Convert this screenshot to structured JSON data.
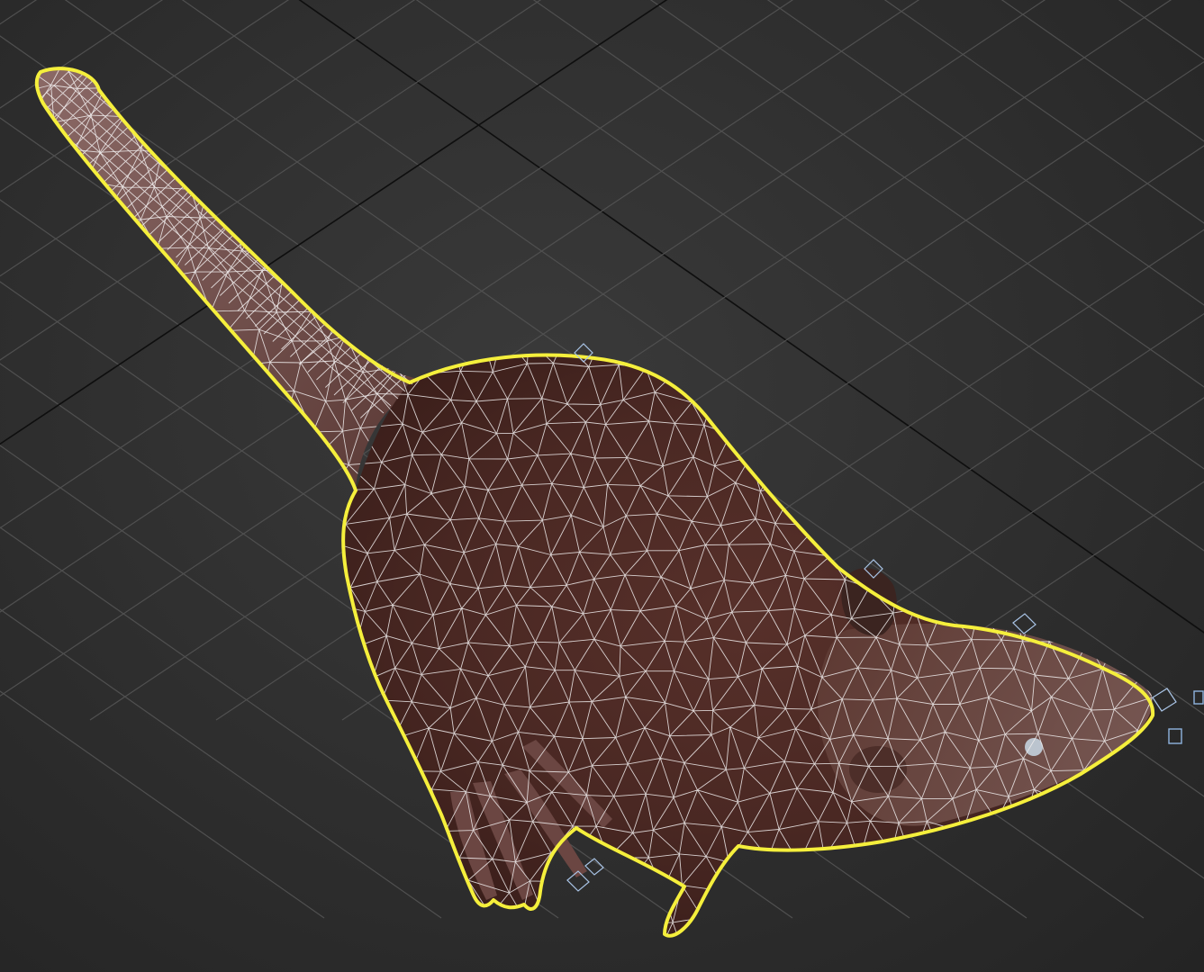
{
  "viewport": {
    "background_color": "#2b2b2b",
    "grid_color": "#505050",
    "axis_color": "#0e0e0e"
  },
  "model": {
    "object": "rat",
    "selected": true,
    "display_mode": "shaded-wireframe",
    "selection_color": "#f5ef3c",
    "wireframe_color": "#f1eded",
    "surface_color": "#5a3028",
    "tail_color": "#7a5552"
  },
  "gizmos": {
    "helper_icon": "bone-helper-icon",
    "helper_color": "#a9c4e6"
  }
}
